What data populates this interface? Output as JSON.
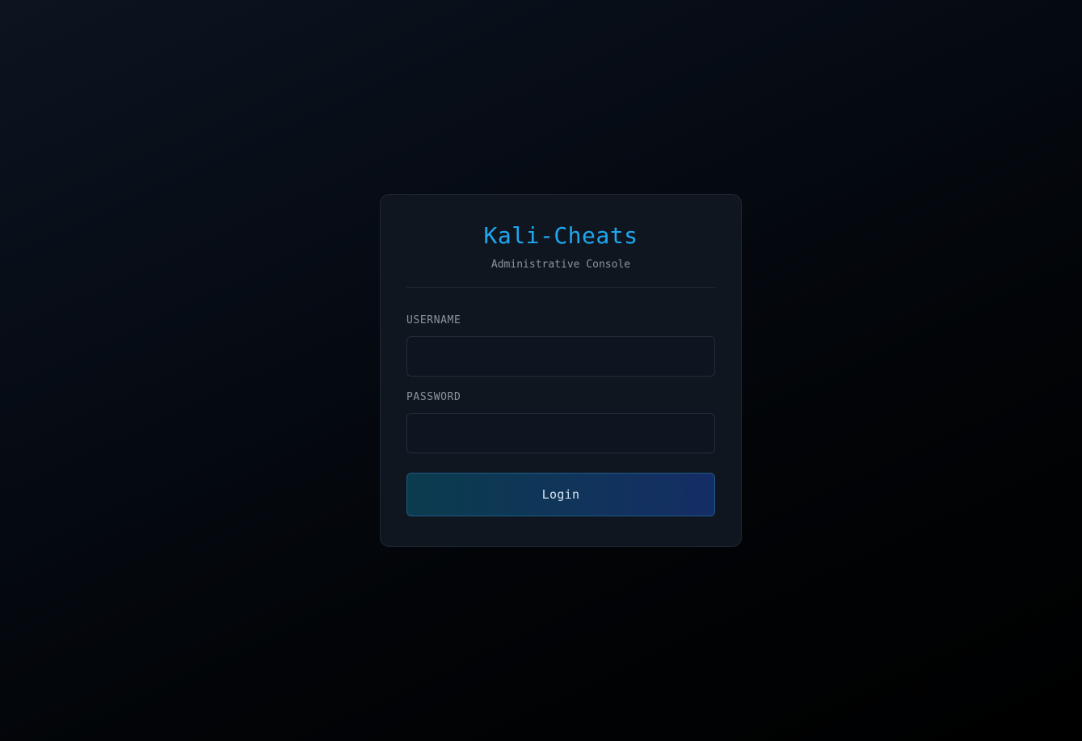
{
  "header": {
    "title": "Kali-Cheats",
    "subtitle": "Administrative Console"
  },
  "form": {
    "username": {
      "label": "USERNAME",
      "value": "",
      "placeholder": ""
    },
    "password": {
      "label": "PASSWORD",
      "value": "",
      "placeholder": ""
    },
    "submit_label": "Login"
  },
  "colors": {
    "accent": "#1ea7f0",
    "card_background": "#10161f",
    "page_background": "#05090f"
  }
}
